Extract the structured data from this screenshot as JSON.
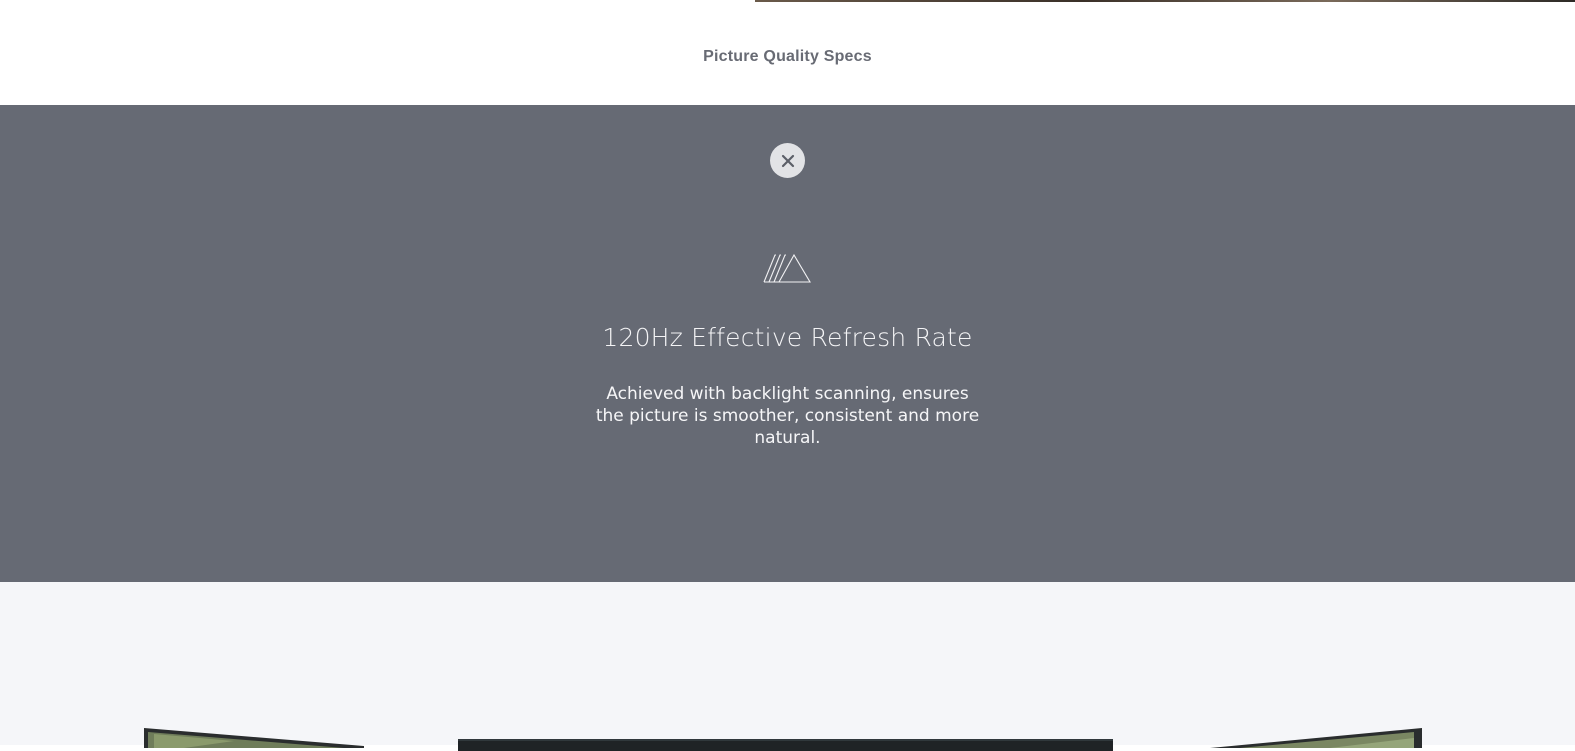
{
  "header": {
    "title": "Picture Quality Specs"
  },
  "panel": {
    "close_icon": "close-icon",
    "feature_icon": "mountains-icon",
    "title": "120Hz Effective Refresh Rate",
    "description": "Achieved with backlight scanning, ensures the picture is smoother, consistent and more natural."
  },
  "colors": {
    "panel_background": "#666a74",
    "header_text": "#686b74",
    "close_button_bg": "#e2e3e6",
    "bottom_background": "#f5f6f9"
  }
}
